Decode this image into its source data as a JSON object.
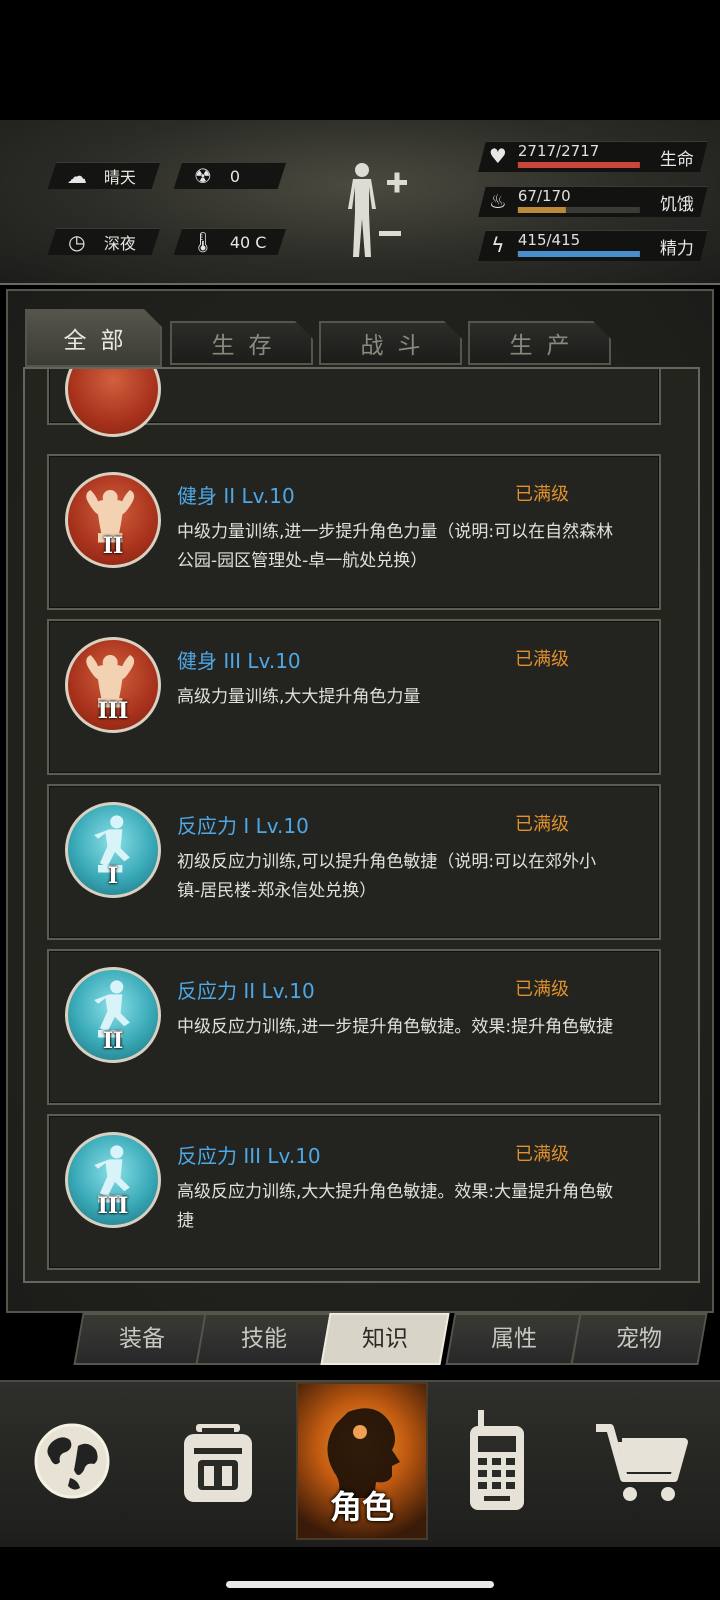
{
  "hud": {
    "weather": {
      "icon": "cloud-sun-icon",
      "label": "晴天"
    },
    "radiation": {
      "icon": "radiation-icon",
      "value": "0"
    },
    "time": {
      "icon": "clock-icon",
      "label": "深夜"
    },
    "temperature": {
      "icon": "thermometer-icon",
      "value": "40 C"
    },
    "stats": [
      {
        "icon": "heart-pulse-icon",
        "value": "2717/2717",
        "label": "生命",
        "fraction": 1.0,
        "color": "#c8463a"
      },
      {
        "icon": "stomach-icon",
        "value": "67/170",
        "label": "饥饿",
        "fraction": 0.39,
        "color": "#b88a3a"
      },
      {
        "icon": "energy-head-icon",
        "value": "415/415",
        "label": "精力",
        "fraction": 1.0,
        "color": "#4a8ed0"
      }
    ],
    "body_icon": "body-figure-icon"
  },
  "tabs": [
    {
      "label": "全部",
      "active": true
    },
    {
      "label": "生存",
      "active": false
    },
    {
      "label": "战斗",
      "active": false
    },
    {
      "label": "生产",
      "active": false
    }
  ],
  "skills": [
    {
      "name": "健身 II Lv.10",
      "status": "已满级",
      "desc": "中级力量训练,进一步提升角色力量（说明:可以在自然森林公园-园区管理处-卓一航处兑换）",
      "icon": "muscle-icon",
      "roman": "II",
      "color": "red"
    },
    {
      "name": "健身 III Lv.10",
      "status": "已满级",
      "desc": "高级力量训练,大大提升角色力量",
      "icon": "muscle-icon",
      "roman": "III",
      "color": "red"
    },
    {
      "name": "反应力 I Lv.10",
      "status": "已满级",
      "desc": "初级反应力训练,可以提升角色敏捷（说明:可以在郊外小镇-居民楼-郑永信处兑换）",
      "icon": "reflex-pose-icon",
      "roman": "I",
      "color": "teal"
    },
    {
      "name": "反应力 II Lv.10",
      "status": "已满级",
      "desc": "中级反应力训练,进一步提升角色敏捷。效果:提升角色敏捷",
      "icon": "reflex-pose-icon",
      "roman": "II",
      "color": "teal"
    },
    {
      "name": "反应力 III Lv.10",
      "status": "已满级",
      "desc": "高级反应力训练,大大提升角色敏捷。效果:大量提升角色敏捷",
      "icon": "reflex-pose-icon",
      "roman": "III",
      "color": "teal"
    }
  ],
  "sub_tabs": [
    {
      "label": "装备",
      "active": false
    },
    {
      "label": "技能",
      "active": false
    },
    {
      "label": "知识",
      "active": true
    },
    {
      "label": "属性",
      "active": false
    },
    {
      "label": "宠物",
      "active": false
    }
  ],
  "bottom_nav": [
    {
      "icon": "globe-icon",
      "label": ""
    },
    {
      "icon": "backpack-icon",
      "label": ""
    },
    {
      "icon": "character-head-icon",
      "label": "角色",
      "active": true
    },
    {
      "icon": "walkie-talkie-icon",
      "label": ""
    },
    {
      "icon": "shopping-cart-icon",
      "label": ""
    }
  ]
}
